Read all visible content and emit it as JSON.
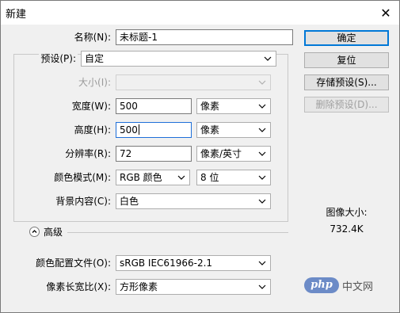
{
  "window": {
    "title": "新建",
    "close_glyph": "✕"
  },
  "fields": {
    "name": {
      "label": "名称(N):",
      "value": "未标题-1"
    },
    "preset": {
      "label": "预设(P):",
      "value": "自定"
    },
    "size": {
      "label": "大小(I):",
      "value": ""
    },
    "width": {
      "label": "宽度(W):",
      "value": "500",
      "unit": "像素"
    },
    "height": {
      "label": "高度(H):",
      "value": "500",
      "unit": "像素"
    },
    "resolution": {
      "label": "分辨率(R):",
      "value": "72",
      "unit": "像素/英寸"
    },
    "color_mode": {
      "label": "颜色模式(M):",
      "value": "RGB 颜色",
      "depth": "8 位"
    },
    "background": {
      "label": "背景内容(C):",
      "value": "白色"
    },
    "advanced": {
      "label": "高级"
    },
    "color_profile": {
      "label": "颜色配置文件(O):",
      "value": "sRGB IEC61966-2.1"
    },
    "pixel_aspect": {
      "label": "像素长宽比(X):",
      "value": "方形像素"
    }
  },
  "buttons": {
    "ok": "确定",
    "reset": "复位",
    "save_preset": "存储预设(S)...",
    "delete_preset": "删除预设(D)..."
  },
  "image_size": {
    "label": "图像大小:",
    "value": "732.4K"
  },
  "watermark": {
    "logo": "php",
    "text": "中文网"
  }
}
